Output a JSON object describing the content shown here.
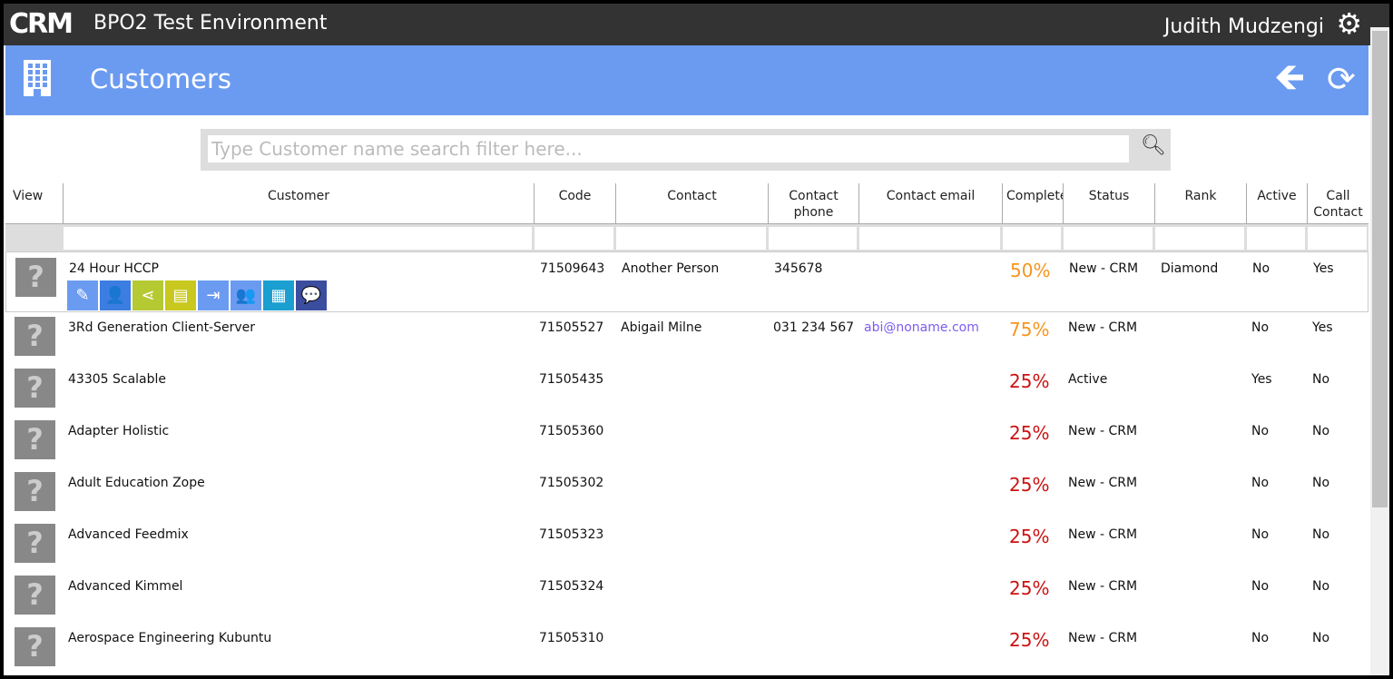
{
  "app": {
    "logo": "CRM",
    "title": "BPO2 Test Environment",
    "user": "Judith Mudzengi"
  },
  "page": {
    "title": "Customers"
  },
  "search": {
    "placeholder": "Type Customer name search filter here..."
  },
  "columns": [
    "View",
    "Customer",
    "Code",
    "Contact",
    "Contact phone",
    "Contact email",
    "Complete",
    "Status",
    "Rank",
    "Active",
    "Call Contact"
  ],
  "column_headers_display": [
    "View",
    "Customer",
    "Code",
    "Contact",
    "Contact\nphone",
    "Contact email",
    "Complet",
    "Status",
    "Rank",
    "Active",
    "Call\nContact"
  ],
  "colors": {
    "topbar": "#333333",
    "band": "#6b9bf0",
    "pct_50": "#f7941d",
    "pct_75": "#f7941d",
    "pct_25": "#cc1111",
    "email": "#7b5cf0"
  },
  "row_actions": [
    {
      "icon": "edit-icon",
      "color": "#6b9bf0"
    },
    {
      "icon": "add-contact-icon",
      "color": "#3b7de0"
    },
    {
      "icon": "share-icon",
      "color": "#b5c932"
    },
    {
      "icon": "document-icon",
      "color": "#c8c81e"
    },
    {
      "icon": "login-icon",
      "color": "#6b9bf0"
    },
    {
      "icon": "users-icon",
      "color": "#6b9bf0"
    },
    {
      "icon": "calendar-icon",
      "color": "#1a9fd0"
    },
    {
      "icon": "chat-icon",
      "color": "#3b4d9e"
    }
  ],
  "rows": [
    {
      "customer": "24 Hour HCCP",
      "code": "71509643",
      "contact": "Another Person",
      "phone": "345678",
      "email": "",
      "complete": "50%",
      "status": "New - CRM",
      "rank": "Diamond",
      "active": "No",
      "call": "Yes"
    },
    {
      "customer": "3Rd Generation Client-Server",
      "code": "71505527",
      "contact": "Abigail Milne",
      "phone": "031 234 567",
      "email": "abi@noname.com",
      "complete": "75%",
      "status": "New - CRM",
      "rank": "",
      "active": "No",
      "call": "Yes"
    },
    {
      "customer": "43305 Scalable",
      "code": "71505435",
      "contact": "",
      "phone": "",
      "email": "",
      "complete": "25%",
      "status": "Active",
      "rank": "",
      "active": "Yes",
      "call": "No"
    },
    {
      "customer": "Adapter Holistic",
      "code": "71505360",
      "contact": "",
      "phone": "",
      "email": "",
      "complete": "25%",
      "status": "New - CRM",
      "rank": "",
      "active": "No",
      "call": "No"
    },
    {
      "customer": "Adult Education Zope",
      "code": "71505302",
      "contact": "",
      "phone": "",
      "email": "",
      "complete": "25%",
      "status": "New - CRM",
      "rank": "",
      "active": "No",
      "call": "No"
    },
    {
      "customer": "Advanced Feedmix",
      "code": "71505323",
      "contact": "",
      "phone": "",
      "email": "",
      "complete": "25%",
      "status": "New - CRM",
      "rank": "",
      "active": "No",
      "call": "No"
    },
    {
      "customer": "Advanced Kimmel",
      "code": "71505324",
      "contact": "",
      "phone": "",
      "email": "",
      "complete": "25%",
      "status": "New - CRM",
      "rank": "",
      "active": "No",
      "call": "No"
    },
    {
      "customer": "Aerospace Engineering Kubuntu",
      "code": "71505310",
      "contact": "",
      "phone": "",
      "email": "",
      "complete": "25%",
      "status": "New - CRM",
      "rank": "",
      "active": "No",
      "call": "No"
    }
  ]
}
